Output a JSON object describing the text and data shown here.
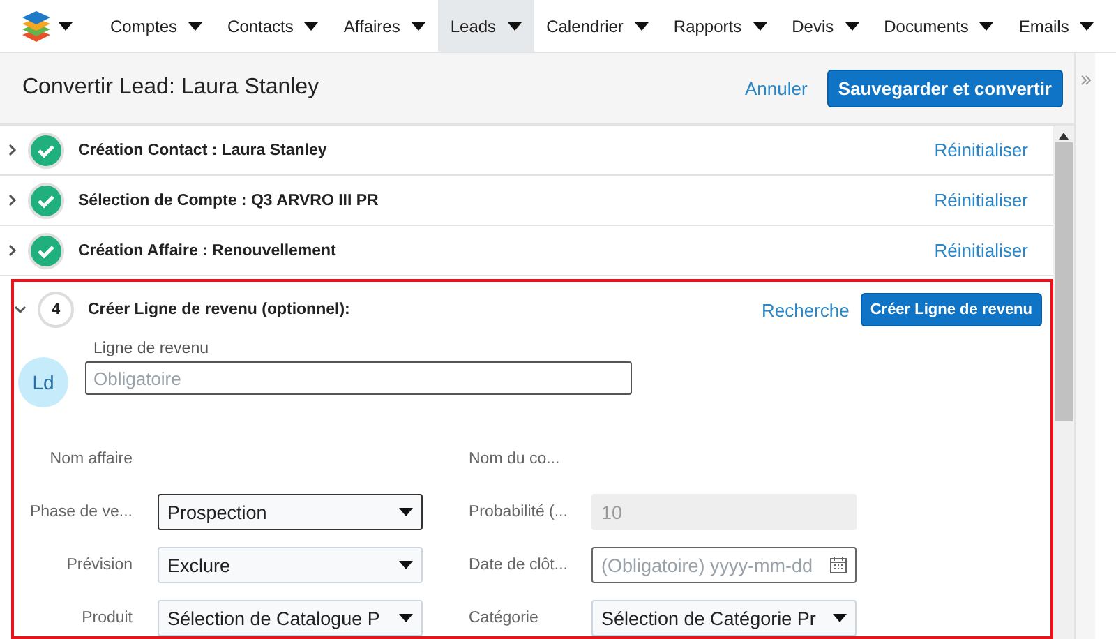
{
  "nav": {
    "items": [
      {
        "label": "Comptes",
        "selected": false
      },
      {
        "label": "Contacts",
        "selected": false
      },
      {
        "label": "Affaires",
        "selected": false
      },
      {
        "label": "Leads",
        "selected": true
      },
      {
        "label": "Calendrier",
        "selected": false
      },
      {
        "label": "Rapports",
        "selected": false
      },
      {
        "label": "Devis",
        "selected": false
      },
      {
        "label": "Documents",
        "selected": false
      },
      {
        "label": "Emails",
        "selected": false
      }
    ]
  },
  "header": {
    "title": "Convertir Lead: Laura Stanley",
    "cancel": "Annuler",
    "save": "Sauvegarder et convertir"
  },
  "steps": [
    {
      "kind": "done",
      "title": "Création Contact : Laura Stanley",
      "expanded": false,
      "reset": "Réinitialiser"
    },
    {
      "kind": "done",
      "title": "Sélection de Compte : Q3 ARVRO III PR",
      "expanded": false,
      "reset": "Réinitialiser"
    },
    {
      "kind": "done",
      "title": "Création Affaire : Renouvellement",
      "expanded": false,
      "reset": "Réinitialiser"
    }
  ],
  "active_step": {
    "number": "4",
    "title": "Créer Ligne de revenu (optionnel):",
    "expanded": true,
    "highlighted": true,
    "search": "Recherche",
    "create": "Créer Ligne de revenu",
    "avatar": "Ld",
    "name_label": "Ligne de revenu",
    "name_placeholder": "Obligatoire",
    "fields": [
      {
        "kind": "text",
        "label": "Nom affaire"
      },
      {
        "kind": "text",
        "label": "Nom du co..."
      },
      {
        "kind": "select",
        "label": "Phase de ve...",
        "value": "Prospection",
        "focused": true
      },
      {
        "kind": "readonly",
        "label": "Probabilité (...",
        "value": "10"
      },
      {
        "kind": "select",
        "label": "Prévision",
        "value": "Exclure",
        "focused": false
      },
      {
        "kind": "date",
        "label": "Date de clôt...",
        "placeholder": "(Obligatoire) yyyy-mm-dd"
      },
      {
        "kind": "select",
        "label": "Produit",
        "value": "Sélection de Catalogue P",
        "focused": false
      },
      {
        "kind": "select",
        "label": "Catégorie",
        "value": "Sélection de Catégorie Pr",
        "focused": false
      }
    ]
  }
}
